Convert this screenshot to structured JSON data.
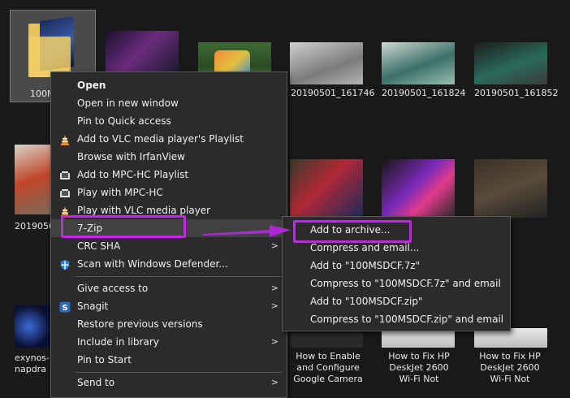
{
  "folder": {
    "name_partial": "100M"
  },
  "thumbnails": [
    {
      "caption": "20190501_161746"
    },
    {
      "caption": "20190501_161824"
    },
    {
      "caption": "20190501_161852"
    },
    {
      "caption": "2019050"
    },
    {
      "caption_lines": [
        "exynos-",
        "napdra"
      ]
    },
    {
      "caption_lines": [
        "How to Enable",
        "and Configure",
        "Google Camera"
      ]
    },
    {
      "caption_lines": [
        "How to Fix HP",
        "DeskJet 2600",
        "Wi-Fi Not"
      ]
    },
    {
      "caption_lines": [
        "How to Fix HP",
        "DeskJet 2600",
        "Wi-Fi Not"
      ]
    }
  ],
  "context_menu": {
    "items": [
      {
        "label": "Open",
        "bold": true
      },
      {
        "label": "Open in new window"
      },
      {
        "label": "Pin to Quick access"
      },
      {
        "label": "Add to VLC media player's Playlist",
        "icon": "vlc-cone-icon"
      },
      {
        "label": "Browse with IrfanView"
      },
      {
        "label": "Add to MPC-HC Playlist",
        "icon": "mpc-film-icon"
      },
      {
        "label": "Play with MPC-HC",
        "icon": "mpc-film-icon"
      },
      {
        "label": "Play with VLC media player",
        "icon": "vlc-cone-icon"
      },
      {
        "label": "7-Zip",
        "submenu": true
      },
      {
        "label": "CRC SHA",
        "submenu": true
      },
      {
        "label": "Scan with Windows Defender...",
        "icon": "defender-shield-icon"
      },
      {
        "label": "Give access to",
        "submenu": true
      },
      {
        "label": "Snagit",
        "submenu": true,
        "icon": "snagit-icon"
      },
      {
        "label": "Restore previous versions"
      },
      {
        "label": "Include in library",
        "submenu": true
      },
      {
        "label": "Pin to Start"
      },
      {
        "label": "Send to",
        "submenu": true
      }
    ],
    "submenu_arrow": ">"
  },
  "submenu_7zip": {
    "items": [
      {
        "label": "Add to archive..."
      },
      {
        "label": "Compress and email..."
      },
      {
        "label": "Add to \"100MSDCF.7z\""
      },
      {
        "label": "Compress to \"100MSDCF.7z\" and email"
      },
      {
        "label": "Add to \"100MSDCF.zip\""
      },
      {
        "label": "Compress to \"100MSDCF.zip\" and email"
      }
    ]
  },
  "colors": {
    "highlight_outline": "#b42fd6",
    "arrow": "#a92ad0",
    "menu_bg": "#2b2b2b",
    "background": "#191919"
  }
}
